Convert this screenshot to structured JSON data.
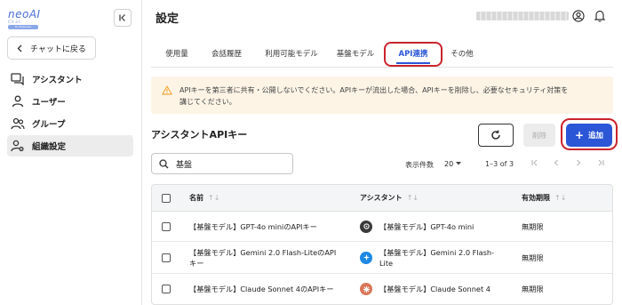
{
  "sidebar": {
    "logo": {
      "line1": "neoAI",
      "line2": "Chat",
      "line3": "for Business"
    },
    "back_label": "チャットに戻る",
    "items": [
      {
        "label": "アシスタント",
        "icon": "assistant-icon"
      },
      {
        "label": "ユーザー",
        "icon": "user-icon"
      },
      {
        "label": "グループ",
        "icon": "group-icon"
      },
      {
        "label": "組織設定",
        "icon": "org-settings-icon",
        "active": true
      }
    ]
  },
  "header": {
    "title": "設定",
    "icons": [
      "account-circle-icon",
      "bell-icon"
    ]
  },
  "tabs": [
    {
      "label": "使用量"
    },
    {
      "label": "会話履歴"
    },
    {
      "label": "利用可能モデル"
    },
    {
      "label": "基盤モデル"
    },
    {
      "label": "API連携",
      "active": true
    },
    {
      "label": "その他"
    }
  ],
  "warning": {
    "text_line1": "APIキーを第三者に共有・公開しないでください。APIキーが流出した場合、APIキーを削除し、必要なセキュリティ対策を",
    "text_line2": "講じてください。"
  },
  "section": {
    "title": "アシスタントAPIキー",
    "delete_label": "削除",
    "add_label": "追加"
  },
  "search": {
    "value": "基盤",
    "placeholder": ""
  },
  "pagination": {
    "per_page_label": "表示件数",
    "per_page_value": "20",
    "range": "1–3 of 3"
  },
  "table": {
    "columns": [
      "名前",
      "アシスタント",
      "有効期限"
    ],
    "rows": [
      {
        "name": "【基盤モデル】GPT-4o miniのAPIキー",
        "assistant": "【基盤モデル】GPT-4o mini",
        "icon_color": "#3a3a3a",
        "expiry": "無期限"
      },
      {
        "name_line1": "【基盤モデル】Gemini 2.0 Flash-LiteのAPI",
        "name_line2": "キー",
        "assistant_line1": "【基盤モデル】Gemini 2.0 Flash-",
        "assistant_line2": "Lite",
        "icon_color": "#1e88e5",
        "expiry": "無期限"
      },
      {
        "name": "【基盤モデル】Claude Sonnet 4のAPIキー",
        "assistant": "【基盤モデル】Claude Sonnet 4",
        "icon_color": "#d9775a",
        "expiry": "無期限"
      }
    ]
  },
  "colors": {
    "accent": "#2b56d6",
    "highlight_circle": "#c9242c",
    "warning_bg": "#fdf4e6",
    "warning_icon": "#f2a93b"
  }
}
